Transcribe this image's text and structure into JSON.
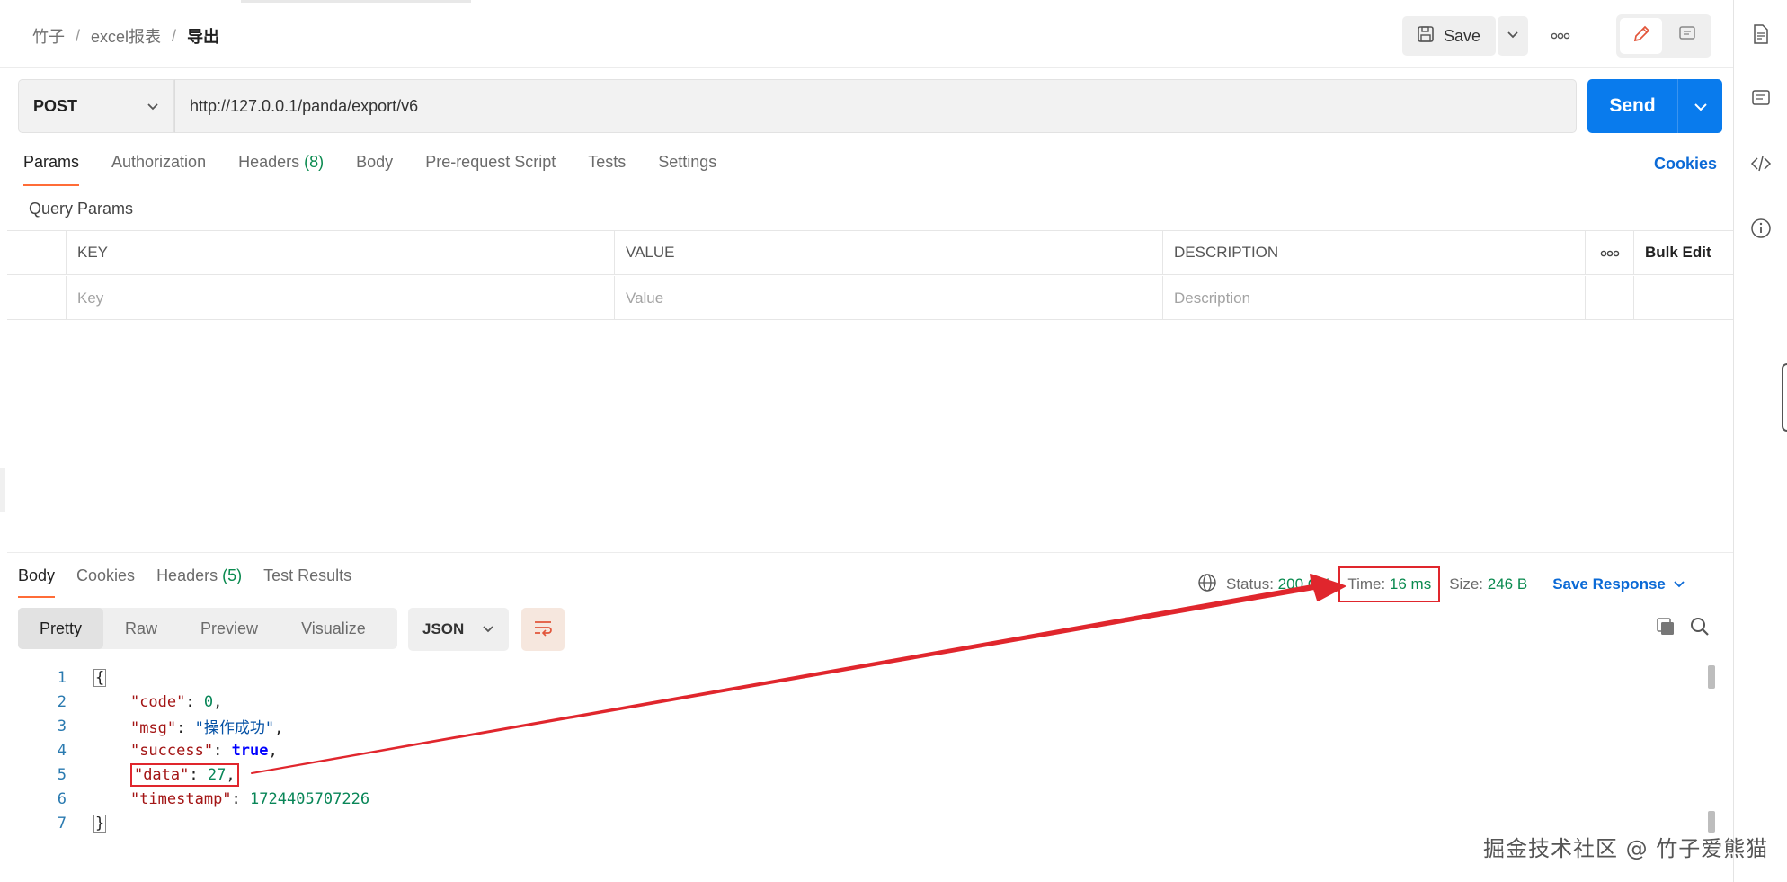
{
  "header": {
    "breadcrumb": [
      "竹子",
      "excel报表",
      "导出"
    ],
    "breadcrumb_sep": "/",
    "save_label": "Save"
  },
  "request": {
    "method": "POST",
    "url": "http://127.0.0.1/panda/export/v6",
    "send_label": "Send",
    "tabs": [
      {
        "label": "Params"
      },
      {
        "label": "Authorization"
      },
      {
        "label": "Headers",
        "count": "(8)"
      },
      {
        "label": "Body"
      },
      {
        "label": "Pre-request Script"
      },
      {
        "label": "Tests"
      },
      {
        "label": "Settings"
      }
    ],
    "cookies_label": "Cookies",
    "query_params_label": "Query Params",
    "table": {
      "headers": [
        "KEY",
        "VALUE",
        "DESCRIPTION"
      ],
      "bulk_edit_label": "Bulk Edit",
      "placeholders": [
        "Key",
        "Value",
        "Description"
      ]
    }
  },
  "response": {
    "tabs": [
      {
        "label": "Body"
      },
      {
        "label": "Cookies"
      },
      {
        "label": "Headers",
        "count": "(5)"
      },
      {
        "label": "Test Results"
      }
    ],
    "status_label": "Status:",
    "status_value": "200 OK",
    "time_label": "Time:",
    "time_value": "16 ms",
    "size_label": "Size:",
    "size_value": "246 B",
    "save_response_label": "Save Response",
    "view_modes": [
      "Pretty",
      "Raw",
      "Preview",
      "Visualize"
    ],
    "format": "JSON",
    "line_numbers": [
      "1",
      "2",
      "3",
      "4",
      "5",
      "6",
      "7"
    ],
    "body": {
      "open_brace": "{",
      "close_brace": "}",
      "code_key": "\"code\"",
      "code_val": "0",
      "msg_key": "\"msg\"",
      "msg_val": "\"操作成功\"",
      "success_key": "\"success\"",
      "success_val": "true",
      "data_key": "\"data\"",
      "data_val": "27",
      "timestamp_key": "\"timestamp\"",
      "timestamp_val": "1724405707226"
    }
  },
  "watermark": "掘金技术社区 @ 竹子爱熊猫",
  "colors": {
    "accent_orange": "#ff6c37",
    "send_blue": "#097bed",
    "annotation_red": "#e0262d",
    "status_green": "#0a8a4f"
  }
}
